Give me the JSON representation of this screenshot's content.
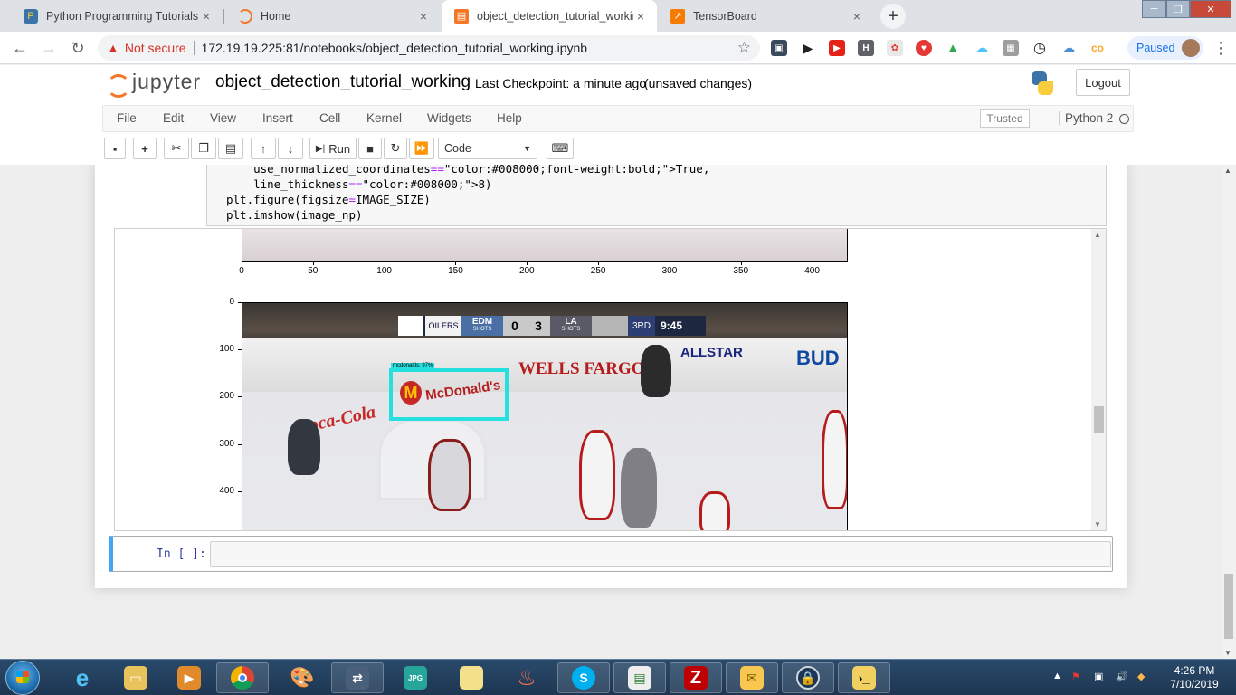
{
  "browser": {
    "tabs": [
      {
        "title": "Python Programming Tutorials",
        "active": false
      },
      {
        "title": "Home",
        "active": false
      },
      {
        "title": "object_detection_tutorial_working",
        "active": true
      },
      {
        "title": "TensorBoard",
        "active": false
      }
    ],
    "new_tab_icon": "+",
    "close_icon": "×",
    "security_label": "Not secure",
    "url": "172.19.19.225:81/notebooks/object_detection_tutorial_working.ipynb",
    "profile_status": "Paused"
  },
  "jupyter": {
    "logo_text": "jupyter",
    "notebook_name": "object_detection_tutorial_working",
    "checkpoint": "Last Checkpoint: a minute ago",
    "save_status": "(unsaved changes)",
    "logout_label": "Logout",
    "menu": [
      "File",
      "Edit",
      "View",
      "Insert",
      "Cell",
      "Kernel",
      "Widgets",
      "Help"
    ],
    "trusted_label": "Trusted",
    "kernel_name": "Python 2",
    "toolbar": {
      "run_label": "Run",
      "cell_type": "Code"
    }
  },
  "cell": {
    "code_lines": [
      {
        "indent": "    ",
        "text": "use_normalized_coordinates=True,"
      },
      {
        "indent": "    ",
        "text": "line_thickness=8)"
      },
      {
        "indent": "",
        "text": "plt.figure(figsize=IMAGE_SIZE)"
      },
      {
        "indent": "",
        "text": "plt.imshow(image_np)"
      }
    ]
  },
  "chart_data": [
    {
      "type": "image",
      "xticks": [
        "0",
        "50",
        "100",
        "150",
        "200",
        "250",
        "300",
        "350",
        "400"
      ]
    },
    {
      "type": "image",
      "yticks": [
        "0",
        "100",
        "200",
        "300",
        "400"
      ],
      "scoreboard": {
        "away": "EDM",
        "away_score": "0",
        "home_score": "3",
        "home": "LA",
        "shots_label": "SHOTS",
        "period": "3RD",
        "time": "9:45"
      },
      "board_ads": [
        "WELLS FARGO",
        "ALLSTAR",
        "BUD",
        "Coca-Cola"
      ],
      "detection": {
        "label": "McDonald's",
        "box_color": "#26e0e0"
      }
    }
  ],
  "next_cell": {
    "prompt": "In [ ]:"
  },
  "taskbar": {
    "time": "4:26 PM",
    "date": "7/10/2019"
  },
  "colors": {
    "jupyter_orange": "#f37726",
    "selected_cell_border": "#42a5f5",
    "chrome_warning": "#d93025"
  }
}
